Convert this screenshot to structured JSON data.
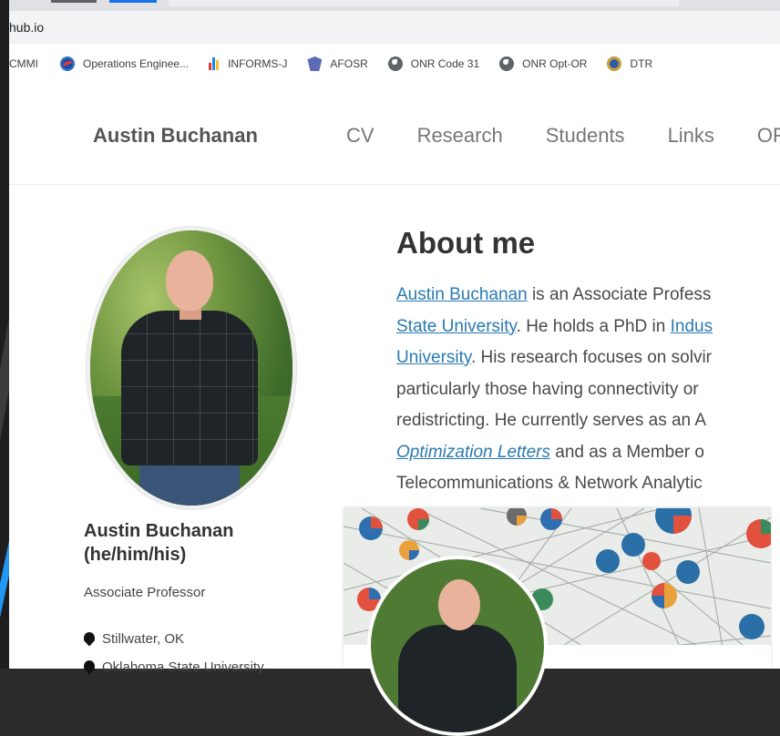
{
  "browser": {
    "url": "hub.io"
  },
  "bookmarks": [
    {
      "label": "CMMI",
      "icon": "none"
    },
    {
      "label": "Operations Enginee...",
      "icon": "nasa-icon"
    },
    {
      "label": "INFORMS-J",
      "icon": "informs-icon"
    },
    {
      "label": "AFOSR",
      "icon": "afosr-icon"
    },
    {
      "label": "ONR Code 31",
      "icon": "globe-icon"
    },
    {
      "label": "ONR Opt-OR",
      "icon": "globe-icon"
    },
    {
      "label": "DTR",
      "icon": "seal-icon"
    }
  ],
  "site": {
    "brand": "Austin Buchanan",
    "nav": [
      "CV",
      "Research",
      "Students",
      "Links",
      "OF"
    ]
  },
  "profile": {
    "name_line1": "Austin Buchanan",
    "name_line2": "(he/him/his)",
    "role": "Associate Professor",
    "location": "Stillwater, OK",
    "affiliation": "Oklahoma State University"
  },
  "about": {
    "title": "About me",
    "lines": [
      [
        {
          "t": "Austin Buchanan",
          "link": true
        },
        {
          "t": " is an Associate Profess"
        }
      ],
      [
        {
          "t": "State University",
          "link": true
        },
        {
          "t": ". He holds a PhD in "
        },
        {
          "t": "Indus",
          "link": true
        }
      ],
      [
        {
          "t": "University",
          "link": true
        },
        {
          "t": ". His research focuses on solvir"
        }
      ],
      [
        {
          "t": "particularly those having connectivity or"
        }
      ],
      [
        {
          "t": "redistricting. He currently serves as an A"
        }
      ],
      [
        {
          "t": "Optimization Letters",
          "link": true,
          "italic": true
        },
        {
          "t": " and as a Member o"
        }
      ],
      [
        {
          "t": "Telecommunications & Network Analytic"
        }
      ]
    ]
  },
  "colors": {
    "link": "#2a7ab0",
    "brand_text": "#555555",
    "nav_text": "#777777"
  }
}
